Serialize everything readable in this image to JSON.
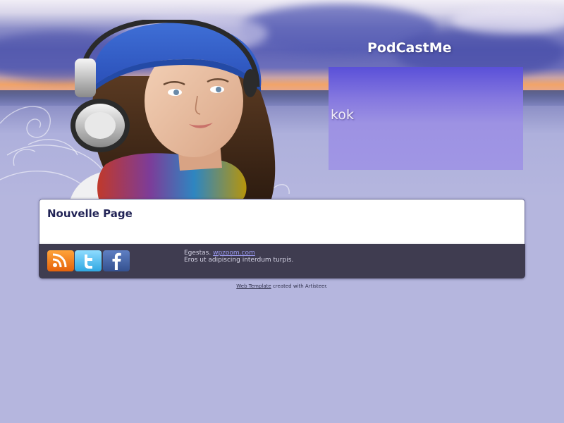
{
  "header": {
    "site_title": "PodCastMe",
    "slogan": "kok"
  },
  "content": {
    "page_title": "Nouvelle Page"
  },
  "footer": {
    "social_icons": [
      "rss-icon",
      "twitter-icon",
      "facebook-icon"
    ],
    "text_prefix": "Egestas.",
    "link_text": "wpzoom.com",
    "line2": "Eros ut adipiscing interdum turpis."
  },
  "credits": {
    "link_text": "Web Template",
    "suffix": "created with Artisteer."
  },
  "colors": {
    "background": "#b5b6de",
    "slogan_box": "#a096e4",
    "footer_bar": "#3f3c50",
    "link": "#9c9cf2"
  }
}
